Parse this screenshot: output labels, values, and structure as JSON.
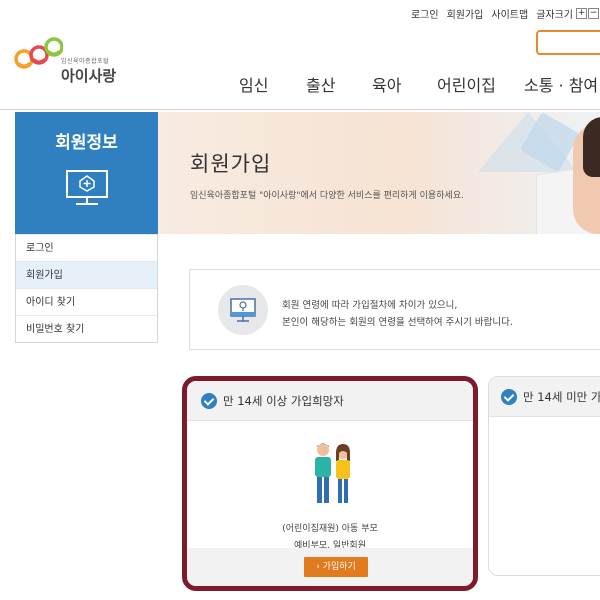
{
  "utility": {
    "login": "로그인",
    "signup": "회원가입",
    "sitemap": "사이트맵",
    "font_size_label": "글자크기",
    "font_plus": "+",
    "font_minus": "−"
  },
  "logo": {
    "subtitle": "임신육아종합포털",
    "name": "아이사랑"
  },
  "gnb": [
    "임신",
    "출산",
    "육아",
    "어린이집",
    "소통 · 참여"
  ],
  "sidebar": {
    "title": "회원정보",
    "items": [
      {
        "label": "로그인",
        "active": false
      },
      {
        "label": "회원가입",
        "active": true
      },
      {
        "label": "아이디 찾기",
        "active": false
      },
      {
        "label": "비밀번호 찾기",
        "active": false
      }
    ]
  },
  "banner": {
    "title": "회원가입",
    "description": "임신육아종합포털 \"아이사랑\"에서 다양한 서비스를 편리하게 이용하세요."
  },
  "notice": {
    "line1": "회원 연령에 따라 가입절차에 차이가 있으니,",
    "line2": "본인이 해당하는 회원의 연령을 선택하여 주시기 바랍니다."
  },
  "cards": [
    {
      "title": "만 14세 이상 가입희망자",
      "desc1": "(어린이집재원) 아동 부모",
      "desc2": "예비부모, 일반회원",
      "button": "가입하기"
    },
    {
      "title": "만 14세 미만 가"
    }
  ],
  "colors": {
    "brand_blue": "#2f7fc1",
    "accent_orange": "#e27a1f",
    "highlight_border": "#7e1a2c"
  }
}
